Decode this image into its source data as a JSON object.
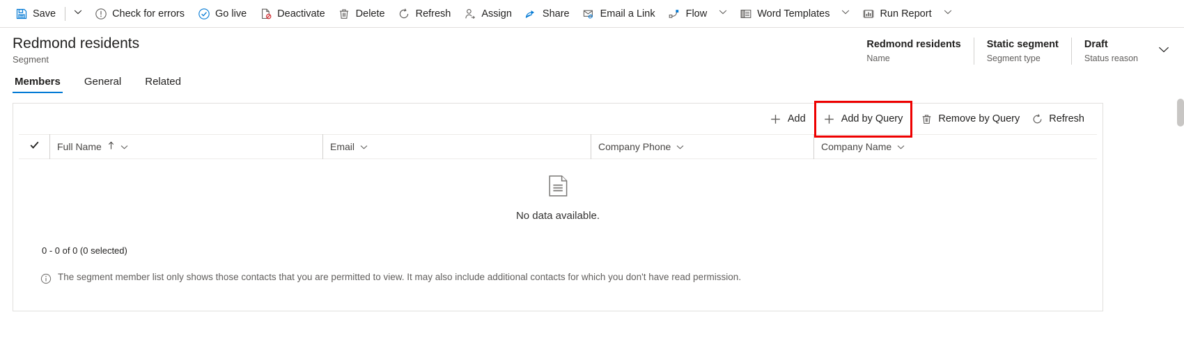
{
  "colors": {
    "accent": "#0078d4",
    "highlight": "#ee0000",
    "text": "#201f1e",
    "subtext": "#605e5c",
    "border": "#e1dfdd"
  },
  "command_bar": {
    "items": [
      {
        "label": "Save",
        "icon": "save-icon"
      },
      {
        "label": "",
        "icon": "chevron-down-icon",
        "type": "caret"
      },
      {
        "label": "Check for errors",
        "icon": "exclamation-circle-icon"
      },
      {
        "label": "Go live",
        "icon": "check-circle-icon"
      },
      {
        "label": "Deactivate",
        "icon": "deactivate-page-icon"
      },
      {
        "label": "Delete",
        "icon": "trash-icon"
      },
      {
        "label": "Refresh",
        "icon": "refresh-icon"
      },
      {
        "label": "Assign",
        "icon": "assign-person-icon"
      },
      {
        "label": "Share",
        "icon": "share-icon"
      },
      {
        "label": "Email a Link",
        "icon": "email-link-icon"
      },
      {
        "label": "Flow",
        "icon": "flow-icon",
        "has_caret": true
      },
      {
        "label": "Word Templates",
        "icon": "word-template-icon",
        "has_caret": true
      },
      {
        "label": "Run Report",
        "icon": "report-chart-icon",
        "has_caret": true
      }
    ]
  },
  "record_header": {
    "title": "Redmond residents",
    "subtitle": "Segment",
    "fields": [
      {
        "value": "Redmond residents",
        "label": "Name"
      },
      {
        "value": "Static segment",
        "label": "Segment type"
      },
      {
        "value": "Draft",
        "label": "Status reason"
      }
    ],
    "expand_icon": "chevron-down-icon"
  },
  "tabs": [
    {
      "label": "Members",
      "selected": true
    },
    {
      "label": "General",
      "selected": false
    },
    {
      "label": "Related",
      "selected": false
    }
  ],
  "grid": {
    "commands": [
      {
        "label": "Add",
        "icon": "plus-icon",
        "highlighted": false
      },
      {
        "label": "Add by Query",
        "icon": "plus-icon",
        "highlighted": true
      },
      {
        "label": "Remove by Query",
        "icon": "trash-icon",
        "highlighted": false
      },
      {
        "label": "Refresh",
        "icon": "refresh-icon",
        "highlighted": false
      }
    ],
    "select_all_icon": "checkmark-icon",
    "columns": [
      {
        "label": "Full Name",
        "sort": "ascending",
        "sort_icon": "arrow-up-icon",
        "menu_icon": "chevron-down-icon"
      },
      {
        "label": "Email",
        "sort": "none",
        "menu_icon": "chevron-down-icon"
      },
      {
        "label": "Company Phone",
        "sort": "none",
        "menu_icon": "chevron-down-icon"
      },
      {
        "label": "Company Name",
        "sort": "none",
        "menu_icon": "chevron-down-icon"
      }
    ],
    "rows": [],
    "empty_state": {
      "icon": "document-icon",
      "message": "No data available."
    },
    "record_count": "0 - 0 of 0 (0 selected)",
    "note": {
      "icon": "info-circle-icon",
      "text": "The segment member list only shows those contacts that you are permitted to view. It may also include additional contacts for which you don't have read permission."
    }
  }
}
